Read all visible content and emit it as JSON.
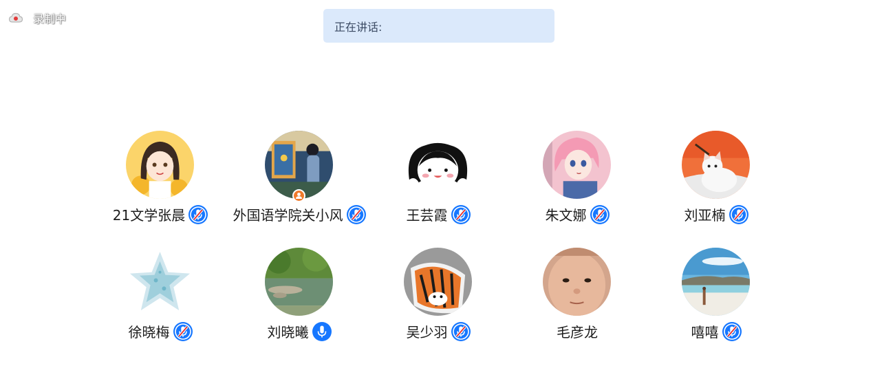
{
  "recording": {
    "label": "录制中",
    "icon": "cloud-record-icon"
  },
  "speaking": {
    "label": "正在讲话:"
  },
  "colors": {
    "accent": "#1677ff",
    "speaking_bg": "#dbe9fb",
    "host_badge": "#f07a2b"
  },
  "participants": [
    {
      "name": "21文学张晨",
      "mic": "muted",
      "avatar": "cartoon-girl-sunflowers"
    },
    {
      "name": "外国语学院关小风",
      "mic": "muted",
      "avatar": "painting-girl-window",
      "host": true
    },
    {
      "name": "王芸霞",
      "mic": "muted",
      "avatar": "cartoon-black-hair-face"
    },
    {
      "name": "朱文娜",
      "mic": "muted",
      "avatar": "anime-girl-pink"
    },
    {
      "name": "刘亚楠",
      "mic": "muted",
      "avatar": "white-kitten"
    },
    {
      "name": "徐晓梅",
      "mic": "muted",
      "avatar": "star-word-cloud"
    },
    {
      "name": "刘晓曦",
      "mic": "on",
      "avatar": "park-pond"
    },
    {
      "name": "吴少羽",
      "mic": "muted",
      "avatar": "tiger-rug"
    },
    {
      "name": "毛彦龙",
      "mic": "none",
      "avatar": "baby-face"
    },
    {
      "name": "嘻嘻",
      "mic": "muted",
      "avatar": "beach-person"
    }
  ]
}
